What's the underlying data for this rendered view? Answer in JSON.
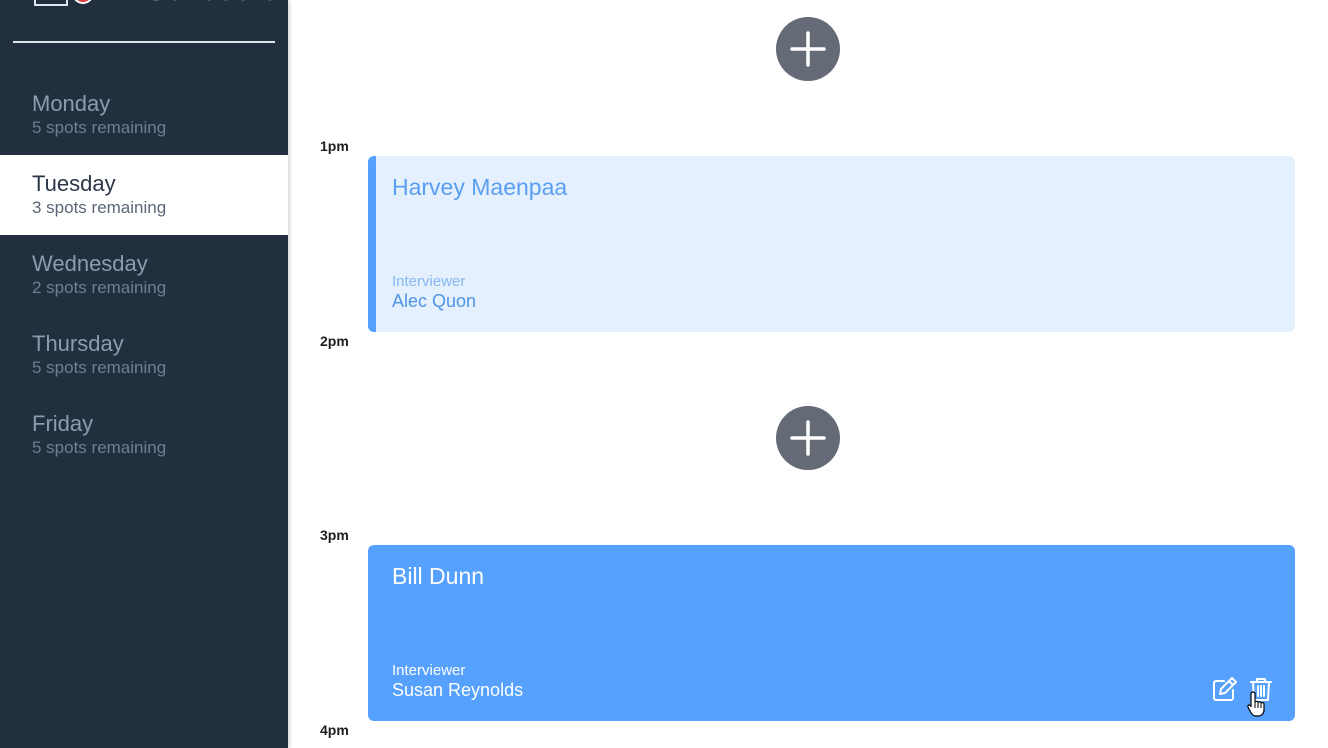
{
  "sidebar": {
    "brand": "Scheduler",
    "days": [
      {
        "name": "Monday",
        "spots": "5 spots remaining"
      },
      {
        "name": "Tuesday",
        "spots": "3 spots remaining"
      },
      {
        "name": "Wednesday",
        "spots": "2 spots remaining"
      },
      {
        "name": "Thursday",
        "spots": "5 spots remaining"
      },
      {
        "name": "Friday",
        "spots": "5 spots remaining"
      }
    ],
    "selected_day": "Tuesday"
  },
  "schedule": {
    "times": [
      "1pm",
      "2pm",
      "3pm",
      "4pm"
    ],
    "appointments": [
      {
        "student": "Harvey Maenpaa",
        "interviewer_label": "Interviewer",
        "interviewer": "Alec Quon"
      },
      {
        "student": "Bill Dunn",
        "interviewer_label": "Interviewer",
        "interviewer": "Susan Reynolds"
      }
    ],
    "add_icon": "plus-icon",
    "edit_icon": "edit-icon",
    "delete_icon": "trash-icon"
  },
  "colors": {
    "sidebar_bg": "#222f3e",
    "accent": "#55a1fd",
    "add_button": "#646b76",
    "appointment_light_bg": "#e4f0fe",
    "logo_red": "#e3383a"
  }
}
